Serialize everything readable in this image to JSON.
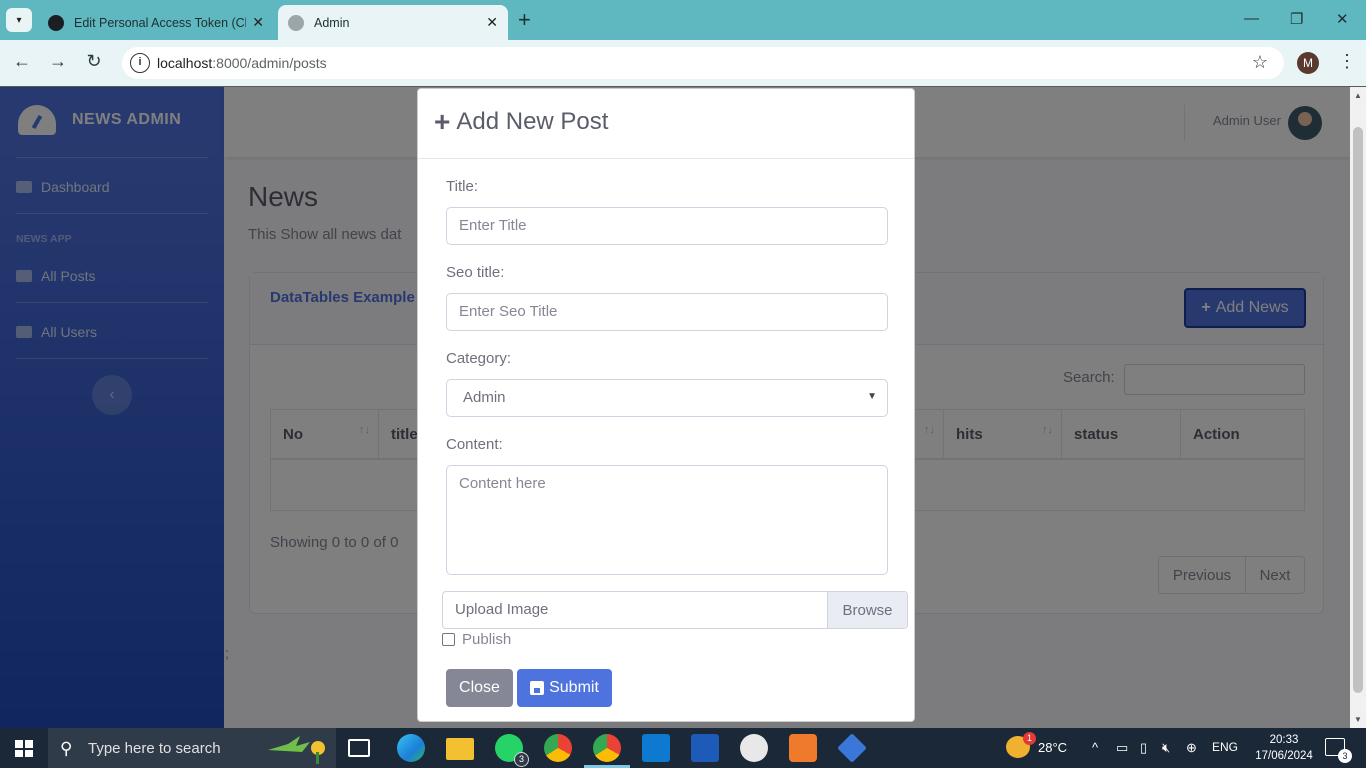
{
  "browser": {
    "tabs": [
      {
        "title": "Edit Personal Access Token (Cla",
        "active": false,
        "favicon": "github-icon"
      },
      {
        "title": "Admin",
        "active": true,
        "favicon": "globe-icon"
      }
    ],
    "url_host": "localhost",
    "url_path": ":8000/admin/posts",
    "profile_initial": "M"
  },
  "sidebar": {
    "brand": "NEWS ADMIN",
    "dashboard": "Dashboard",
    "heading": "NEWS APP",
    "items": [
      {
        "label": "All Posts",
        "icon": "table-icon"
      },
      {
        "label": "All Users",
        "icon": "users-icon"
      }
    ],
    "toggle_icon": "chevron-left-icon"
  },
  "topbar": {
    "user_name": "Admin User"
  },
  "main": {
    "title": "News",
    "subtitle": "This Show all news dat",
    "card_title": "DataTables Example",
    "add_button": "Add News",
    "search_label": "Search:",
    "columns": [
      {
        "label": "No"
      },
      {
        "label": "title"
      },
      {
        "label": "hits"
      },
      {
        "label": "status"
      },
      {
        "label": "Action"
      }
    ],
    "showing": "Showing 0 to 0 of 0",
    "prev": "Previous",
    "next": "Next",
    "stray": ";"
  },
  "modal": {
    "title": "Add New Post",
    "title_label": "Title:",
    "title_placeholder": "Enter Title",
    "seo_label": "Seo title:",
    "seo_placeholder": "Enter Seo Title",
    "category_label": "Category:",
    "category_value": "Admin",
    "content_label": "Content:",
    "content_placeholder": "Content here",
    "upload_label": "Upload Image",
    "browse_label": "Browse",
    "publish_label": "Publish",
    "publish_checked": false,
    "close_button": "Close",
    "submit_button": "Submit"
  },
  "taskbar": {
    "search_placeholder": "Type here to search",
    "whatsapp_badge": "3",
    "weather_badge": "1",
    "temperature": "28°C",
    "language": "ENG",
    "time": "20:33",
    "date": "17/06/2024",
    "notification_count": "3"
  },
  "colors": {
    "primary": "#4e73df",
    "secondary": "#858796",
    "tab_strip": "#5fb8c0",
    "taskbar": "#1a2838"
  }
}
